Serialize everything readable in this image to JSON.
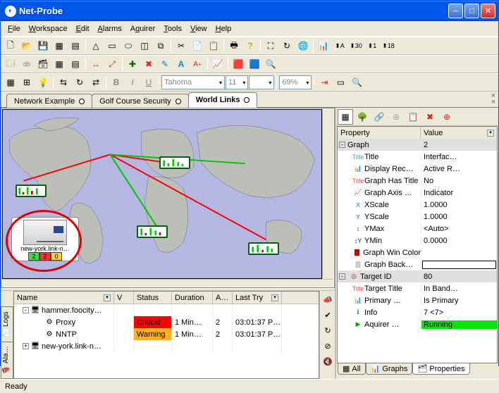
{
  "window": {
    "title": "Net-Probe"
  },
  "menu": {
    "file": "File",
    "workspace": "Workspace",
    "edit": "Edit",
    "alarms": "Alarms",
    "aquirer": "Aquirer",
    "tools": "Tools",
    "view": "View",
    "help": "Help"
  },
  "format": {
    "font": "Tahoma",
    "size": "11",
    "zoom": "69%"
  },
  "tabs": {
    "t1": "Network Example",
    "t2": "Golf Course Security",
    "t3": "World Links"
  },
  "device": {
    "label": "new-york.link-n…",
    "counts": {
      "ok": "2",
      "crit": "2",
      "warn": "0"
    }
  },
  "alarms": {
    "headers": {
      "name": "Name",
      "v": "V",
      "status": "Status",
      "duration": "Duration",
      "a": "A…",
      "last": "Last Try"
    },
    "rows": [
      {
        "name": "hammer.foocity…",
        "status": "",
        "duration": "",
        "a": "",
        "last": "",
        "group": true
      },
      {
        "name": "Proxy",
        "status": "Critical",
        "statusClass": "st-critical",
        "duration": "1 Min…",
        "a": "2",
        "last": "03:01:37 P…"
      },
      {
        "name": "NNTP",
        "status": "Warning",
        "statusClass": "st-warning",
        "duration": "1 Min…",
        "a": "2",
        "last": "03:01:37 P…"
      },
      {
        "name": "new-york.link-n…",
        "status": "",
        "duration": "",
        "a": "",
        "last": "",
        "group": true
      }
    ],
    "sidetabs": {
      "alarms": "Ala…",
      "logs": "Logs"
    }
  },
  "properties": {
    "headers": {
      "property": "Property",
      "value": "Value"
    },
    "rows": [
      {
        "k": "Graph",
        "v": "2",
        "sel": true,
        "indent": 0,
        "toggle": "-"
      },
      {
        "k": "Title",
        "v": "Interfac…",
        "indent": 1,
        "icon": "Title",
        "ic": "#4aa"
      },
      {
        "k": "Display Rec…",
        "v": "Active R…",
        "indent": 1,
        "icon": "📊"
      },
      {
        "k": "Graph Has Title",
        "v": "No",
        "indent": 1,
        "icon": "Title",
        "ic": "#c55"
      },
      {
        "k": "Graph Axis …",
        "v": "Indicator",
        "indent": 1,
        "icon": "📈"
      },
      {
        "k": "XScale",
        "v": "1.0000",
        "indent": 1,
        "icon": "X",
        "ic": "#08c"
      },
      {
        "k": "YScale",
        "v": "1.0000",
        "indent": 1,
        "icon": "Y",
        "ic": "#08c"
      },
      {
        "k": "YMax",
        "v": "<Auto>",
        "indent": 1,
        "icon": "↕",
        "ic": "#048"
      },
      {
        "k": "YMin",
        "v": "0.0000",
        "indent": 1,
        "icon": "↕Y",
        "ic": "#048"
      },
      {
        "k": "Graph Win Color",
        "v": "",
        "vclass": "red",
        "indent": 1,
        "icon": "▇",
        "ic": "#c00"
      },
      {
        "k": "Graph Back…",
        "v": "",
        "vclass": "white-sw",
        "indent": 1,
        "icon": "▇",
        "ic": "#ccc"
      },
      {
        "k": "Target ID",
        "v": "80",
        "sel": true,
        "indent": 0,
        "toggle": "-",
        "icon": "◎",
        "ic": "#c00"
      },
      {
        "k": "Target Title",
        "v": "In Band…",
        "indent": 1,
        "icon": "Title",
        "ic": "#c55"
      },
      {
        "k": "Primary …",
        "v": "Is Primary",
        "indent": 1,
        "icon": "📊"
      },
      {
        "k": "Info",
        "v": "7 <7>",
        "indent": 1,
        "icon": "ℹ",
        "ic": "#08c"
      },
      {
        "k": "Aquirer …",
        "v": "Running",
        "vclass": "running",
        "indent": 1,
        "icon": "▶",
        "ic": "#0a0"
      }
    ],
    "tabs": {
      "all": "All",
      "graphs": "Graphs",
      "props": "Properties"
    }
  },
  "status": {
    "text": "Ready"
  }
}
